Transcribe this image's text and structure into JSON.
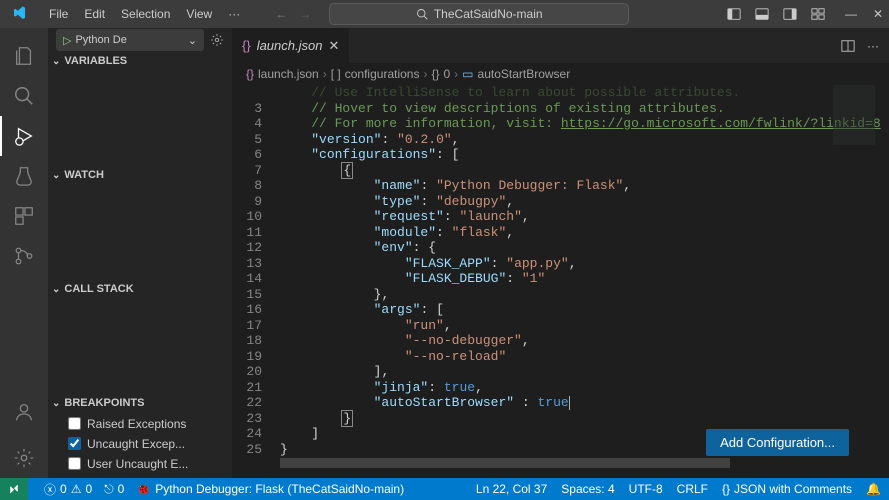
{
  "window": {
    "search_text": "TheCatSaidNo-main"
  },
  "menu": {
    "file": "File",
    "edit": "Edit",
    "selection": "Selection",
    "view": "View"
  },
  "debug_config": {
    "selected": "Python De",
    "label_variables": "VARIABLES",
    "label_watch": "WATCH",
    "label_callstack": "CALL STACK",
    "label_breakpoints": "BREAKPOINTS"
  },
  "breakpoints": {
    "raised": {
      "label": "Raised Exceptions",
      "checked": false
    },
    "uncaught": {
      "label": "Uncaught Excep...",
      "checked": true
    },
    "user_uncaught": {
      "label": "User Uncaught E...",
      "checked": false
    }
  },
  "tab": {
    "filename": "launch.json"
  },
  "breadcrumb": {
    "file": "launch.json",
    "arr": "configurations",
    "idx": "0",
    "prop": "autoStartBrowser"
  },
  "code": {
    "lines": [
      {
        "n": "",
        "t": "    // Use IntelliSense to learn about possible attributes.",
        "cls": "tk-comment dim"
      },
      {
        "n": "3",
        "t": "    // Hover to view descriptions of existing attributes.",
        "cls": "tk-comment"
      },
      {
        "n": "4",
        "t": "    // For more information, visit: https://go.microsoft.com/fwlink/?linkid=8",
        "cls": "tk-comment"
      },
      {
        "n": "5",
        "t": "    \"version\": \"0.2.0\","
      },
      {
        "n": "6",
        "t": "    \"configurations\": ["
      },
      {
        "n": "7",
        "t": "        {"
      },
      {
        "n": "8",
        "t": "            \"name\": \"Python Debugger: Flask\","
      },
      {
        "n": "9",
        "t": "            \"type\": \"debugpy\","
      },
      {
        "n": "10",
        "t": "            \"request\": \"launch\","
      },
      {
        "n": "11",
        "t": "            \"module\": \"flask\","
      },
      {
        "n": "12",
        "t": "            \"env\": {"
      },
      {
        "n": "13",
        "t": "                \"FLASK_APP\": \"app.py\","
      },
      {
        "n": "14",
        "t": "                \"FLASK_DEBUG\": \"1\""
      },
      {
        "n": "15",
        "t": "            },"
      },
      {
        "n": "16",
        "t": "            \"args\": ["
      },
      {
        "n": "17",
        "t": "                \"run\","
      },
      {
        "n": "18",
        "t": "                \"--no-debugger\","
      },
      {
        "n": "19",
        "t": "                \"--no-reload\""
      },
      {
        "n": "20",
        "t": "            ],"
      },
      {
        "n": "21",
        "t": "            \"jinja\": true,"
      },
      {
        "n": "22",
        "t": "            \"autoStartBrowser\" : true"
      },
      {
        "n": "23",
        "t": "        }"
      },
      {
        "n": "24",
        "t": "    ]"
      },
      {
        "n": "25",
        "t": "}"
      }
    ]
  },
  "button": {
    "add_config": "Add Configuration..."
  },
  "status": {
    "errors": "0",
    "warnings": "0",
    "ports": "0",
    "debugger": "Python Debugger: Flask (TheCatSaidNo-main)",
    "ln_col": "Ln 22, Col 37",
    "spaces": "Spaces: 4",
    "encoding": "UTF-8",
    "eol": "CRLF",
    "lang": "JSON with Comments"
  }
}
